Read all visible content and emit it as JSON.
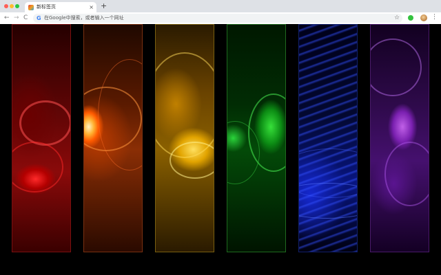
{
  "browser": {
    "tab": {
      "title": "新标签页",
      "close_icon": "close-icon",
      "favicon": "tab-favicon"
    },
    "new_tab_icon": "plus-icon",
    "toolbar": {
      "back_icon": "arrow-left-icon",
      "forward_icon": "arrow-right-icon",
      "reload_icon": "reload-icon",
      "omnibox_icon": "google-g-icon",
      "omnibox_placeholder": "在Google中搜索，或者输入一个网址",
      "bookmark_icon": "star-icon",
      "extension_icon": "green-circle-icon",
      "avatar": "profile-avatar",
      "menu_icon": "kebab-menu-icon"
    }
  },
  "wallpaper": {
    "panels": [
      {
        "id": "red",
        "accent": "#b30000"
      },
      {
        "id": "orange",
        "accent": "#ff5a00"
      },
      {
        "id": "yellow",
        "accent": "#e2a400"
      },
      {
        "id": "green",
        "accent": "#0c8c14"
      },
      {
        "id": "blue",
        "accent": "#1528d0"
      },
      {
        "id": "purple",
        "accent": "#7a20b0"
      }
    ],
    "background": "#000000"
  },
  "labels": {
    "g_glyph": "G",
    "back_glyph": "←",
    "forward_glyph": "→",
    "reload_glyph": "C",
    "close_glyph": "×",
    "plus_glyph": "+",
    "star_glyph": "☆",
    "menu_glyph": "⋮"
  }
}
